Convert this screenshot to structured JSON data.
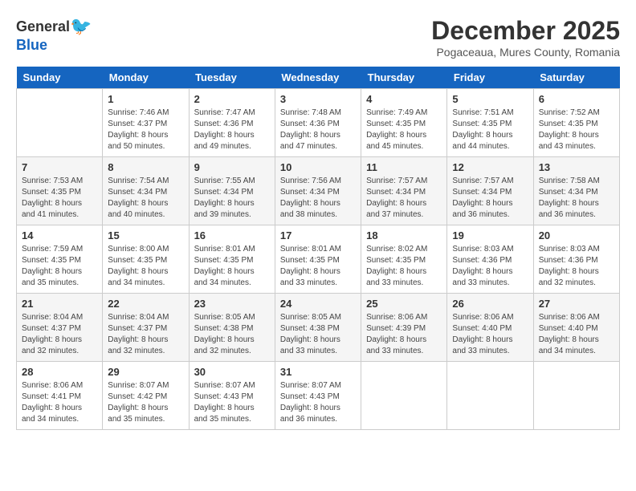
{
  "logo": {
    "general": "General",
    "blue": "Blue"
  },
  "title": {
    "month_year": "December 2025",
    "location": "Pogaceaua, Mures County, Romania"
  },
  "days_of_week": [
    "Sunday",
    "Monday",
    "Tuesday",
    "Wednesday",
    "Thursday",
    "Friday",
    "Saturday"
  ],
  "weeks": [
    [
      {
        "day": "",
        "info": ""
      },
      {
        "day": "1",
        "info": "Sunrise: 7:46 AM\nSunset: 4:37 PM\nDaylight: 8 hours\nand 50 minutes."
      },
      {
        "day": "2",
        "info": "Sunrise: 7:47 AM\nSunset: 4:36 PM\nDaylight: 8 hours\nand 49 minutes."
      },
      {
        "day": "3",
        "info": "Sunrise: 7:48 AM\nSunset: 4:36 PM\nDaylight: 8 hours\nand 47 minutes."
      },
      {
        "day": "4",
        "info": "Sunrise: 7:49 AM\nSunset: 4:35 PM\nDaylight: 8 hours\nand 45 minutes."
      },
      {
        "day": "5",
        "info": "Sunrise: 7:51 AM\nSunset: 4:35 PM\nDaylight: 8 hours\nand 44 minutes."
      },
      {
        "day": "6",
        "info": "Sunrise: 7:52 AM\nSunset: 4:35 PM\nDaylight: 8 hours\nand 43 minutes."
      }
    ],
    [
      {
        "day": "7",
        "info": "Sunrise: 7:53 AM\nSunset: 4:35 PM\nDaylight: 8 hours\nand 41 minutes."
      },
      {
        "day": "8",
        "info": "Sunrise: 7:54 AM\nSunset: 4:34 PM\nDaylight: 8 hours\nand 40 minutes."
      },
      {
        "day": "9",
        "info": "Sunrise: 7:55 AM\nSunset: 4:34 PM\nDaylight: 8 hours\nand 39 minutes."
      },
      {
        "day": "10",
        "info": "Sunrise: 7:56 AM\nSunset: 4:34 PM\nDaylight: 8 hours\nand 38 minutes."
      },
      {
        "day": "11",
        "info": "Sunrise: 7:57 AM\nSunset: 4:34 PM\nDaylight: 8 hours\nand 37 minutes."
      },
      {
        "day": "12",
        "info": "Sunrise: 7:57 AM\nSunset: 4:34 PM\nDaylight: 8 hours\nand 36 minutes."
      },
      {
        "day": "13",
        "info": "Sunrise: 7:58 AM\nSunset: 4:34 PM\nDaylight: 8 hours\nand 36 minutes."
      }
    ],
    [
      {
        "day": "14",
        "info": "Sunrise: 7:59 AM\nSunset: 4:35 PM\nDaylight: 8 hours\nand 35 minutes."
      },
      {
        "day": "15",
        "info": "Sunrise: 8:00 AM\nSunset: 4:35 PM\nDaylight: 8 hours\nand 34 minutes."
      },
      {
        "day": "16",
        "info": "Sunrise: 8:01 AM\nSunset: 4:35 PM\nDaylight: 8 hours\nand 34 minutes."
      },
      {
        "day": "17",
        "info": "Sunrise: 8:01 AM\nSunset: 4:35 PM\nDaylight: 8 hours\nand 33 minutes."
      },
      {
        "day": "18",
        "info": "Sunrise: 8:02 AM\nSunset: 4:35 PM\nDaylight: 8 hours\nand 33 minutes."
      },
      {
        "day": "19",
        "info": "Sunrise: 8:03 AM\nSunset: 4:36 PM\nDaylight: 8 hours\nand 33 minutes."
      },
      {
        "day": "20",
        "info": "Sunrise: 8:03 AM\nSunset: 4:36 PM\nDaylight: 8 hours\nand 32 minutes."
      }
    ],
    [
      {
        "day": "21",
        "info": "Sunrise: 8:04 AM\nSunset: 4:37 PM\nDaylight: 8 hours\nand 32 minutes."
      },
      {
        "day": "22",
        "info": "Sunrise: 8:04 AM\nSunset: 4:37 PM\nDaylight: 8 hours\nand 32 minutes."
      },
      {
        "day": "23",
        "info": "Sunrise: 8:05 AM\nSunset: 4:38 PM\nDaylight: 8 hours\nand 32 minutes."
      },
      {
        "day": "24",
        "info": "Sunrise: 8:05 AM\nSunset: 4:38 PM\nDaylight: 8 hours\nand 33 minutes."
      },
      {
        "day": "25",
        "info": "Sunrise: 8:06 AM\nSunset: 4:39 PM\nDaylight: 8 hours\nand 33 minutes."
      },
      {
        "day": "26",
        "info": "Sunrise: 8:06 AM\nSunset: 4:40 PM\nDaylight: 8 hours\nand 33 minutes."
      },
      {
        "day": "27",
        "info": "Sunrise: 8:06 AM\nSunset: 4:40 PM\nDaylight: 8 hours\nand 34 minutes."
      }
    ],
    [
      {
        "day": "28",
        "info": "Sunrise: 8:06 AM\nSunset: 4:41 PM\nDaylight: 8 hours\nand 34 minutes."
      },
      {
        "day": "29",
        "info": "Sunrise: 8:07 AM\nSunset: 4:42 PM\nDaylight: 8 hours\nand 35 minutes."
      },
      {
        "day": "30",
        "info": "Sunrise: 8:07 AM\nSunset: 4:43 PM\nDaylight: 8 hours\nand 35 minutes."
      },
      {
        "day": "31",
        "info": "Sunrise: 8:07 AM\nSunset: 4:43 PM\nDaylight: 8 hours\nand 36 minutes."
      },
      {
        "day": "",
        "info": ""
      },
      {
        "day": "",
        "info": ""
      },
      {
        "day": "",
        "info": ""
      }
    ]
  ]
}
